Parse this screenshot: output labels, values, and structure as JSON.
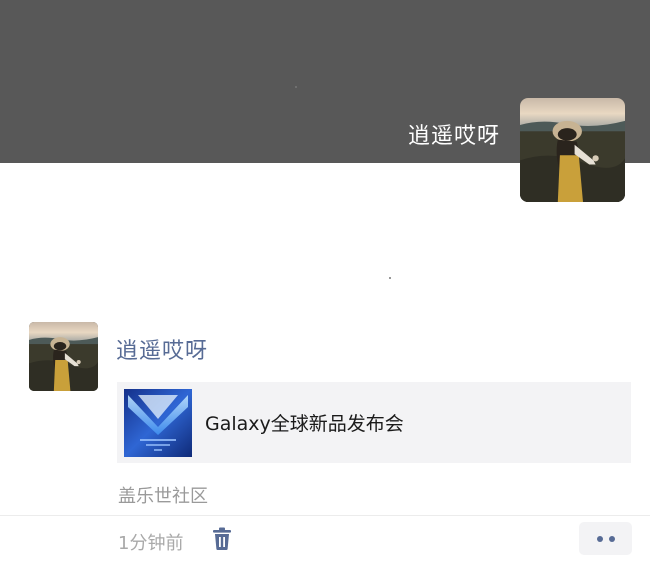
{
  "cover": {
    "user_name": "逍遥哎呀",
    "avatar_icon": "user-avatar-photo"
  },
  "post": {
    "author_name": "逍遥哎呀",
    "avatar_icon": "user-avatar-photo",
    "link": {
      "thumbnail_icon": "galaxy-event-thumbnail",
      "title": "Galaxy全球新品发布会"
    },
    "source": "盖乐世社区",
    "time": "1分钟前",
    "delete_icon": "trash-icon",
    "more_icon": "more-dots-icon"
  },
  "colors": {
    "cover_bg": "#585858",
    "name_link": "#576b95",
    "card_bg": "#f3f3f5",
    "muted_text": "#9a9a9a"
  }
}
